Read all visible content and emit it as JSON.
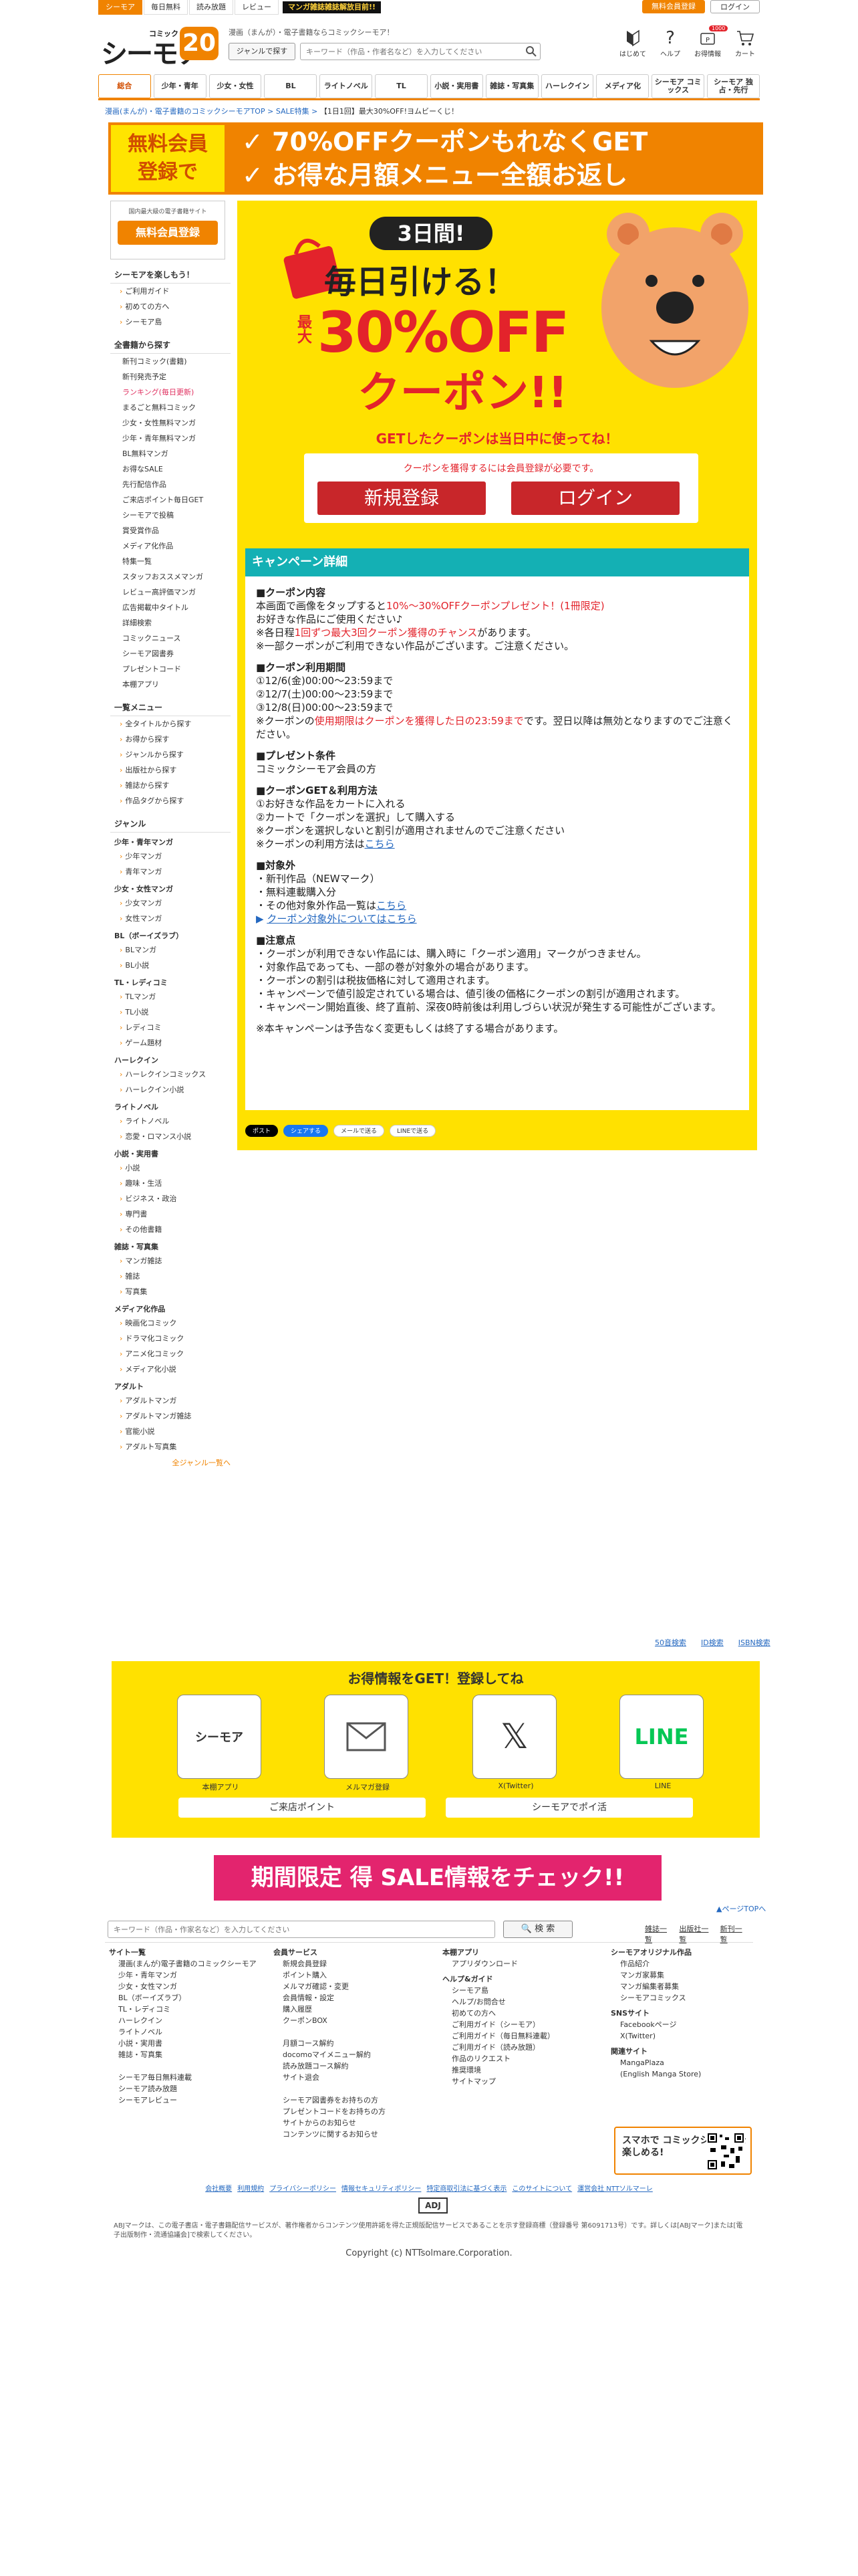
{
  "top_tabs": [
    "シーモア",
    "毎日無料",
    "読み放題",
    "レビュー"
  ],
  "top_banner": "マンガ雑誌雑誌解放目前!!",
  "top_right": {
    "register": "無料会員登録",
    "login": "ログイン"
  },
  "logo": {
    "comic": "コミック",
    "main": "シーモア",
    "anniv": "20"
  },
  "tagline": "漫画（まんが）・電子書籍ならコミックシーモア！",
  "genre_button": "ジャンルで探す",
  "search_placeholder": "キーワード（作品・作者名など）を入力してください",
  "header_icons": [
    "はじめて",
    "ヘルプ",
    "お得情報",
    "カート"
  ],
  "header_badge": "1000",
  "nav": [
    "総合",
    "少年・青年",
    "少女・女性",
    "BL",
    "ライトノベル",
    "TL",
    "小説・実用書",
    "雑誌・写真集",
    "ハーレクイン",
    "メディア化",
    "シーモア コミックス",
    "シーモア 独占・先行"
  ],
  "breadcrumb": {
    "home": "漫画(まんが)・電子書籍のコミックシーモアTOP",
    "sep": " > ",
    "sale": "SALE特集",
    "current": "【1日1回】最大30%OFF!ヨムビーくじ！"
  },
  "promo": {
    "left": [
      "無料会員",
      "登録で"
    ],
    "line1": "✓ 70%OFFクーポンもれなくGET",
    "line2": "✓ お得な月額メニュー全額お返し"
  },
  "sidebar": {
    "member_caption": "国内最大級の電子書籍サイト",
    "member_button": "無料会員登録",
    "enjoy_title": "シーモアを楽しもう！",
    "enjoy": [
      "ご利用ガイド",
      "初めての方へ",
      "シーモア島"
    ],
    "search_title": "全書籍から探す",
    "search_items": [
      "新刊コミック(書籍)",
      "新刊発売予定",
      "ランキング(毎日更新)",
      "まるごと無料コミック",
      "少女・女性無料マンガ",
      "少年・青年無料マンガ",
      "BL無料マンガ",
      "お得なSALE",
      "先行配信作品",
      "ご来店ポイント毎日GET",
      "シーモアで投稿",
      "賞受賞作品",
      "メディア化作品",
      "特集一覧",
      "スタッフおススメマンガ",
      "レビュー高評価マンガ",
      "広告掲載中タイトル",
      "詳細検索",
      "コミックニュース",
      "シーモア図書券",
      "プレゼントコード",
      "本棚アプリ"
    ],
    "list_title": "一覧メニュー",
    "list_items": [
      "全タイトルから探す",
      "お得から探す",
      "ジャンルから探す",
      "出版社から探す",
      "雑誌から探す",
      "作品タグから探す"
    ],
    "genre_title": "ジャンル",
    "genres": [
      {
        "name": "少年・青年マンガ",
        "items": [
          "少年マンガ",
          "青年マンガ"
        ]
      },
      {
        "name": "少女・女性マンガ",
        "items": [
          "少女マンガ",
          "女性マンガ"
        ]
      },
      {
        "name": "BL（ボーイズラブ）",
        "items": [
          "BLマンガ",
          "BL小説"
        ]
      },
      {
        "name": "TL・レディコミ",
        "items": [
          "TLマンガ",
          "TL小説",
          "レディコミ",
          "ゲーム題材"
        ]
      },
      {
        "name": "ハーレクイン",
        "items": [
          "ハーレクインコミックス",
          "ハーレクイン小説"
        ]
      },
      {
        "name": "ライトノベル",
        "items": [
          "ライトノベル",
          "恋愛・ロマンス小説"
        ]
      },
      {
        "name": "小説・実用書",
        "items": [
          "小説",
          "趣味・生活",
          "ビジネス・政治",
          "専門書",
          "その他書籍"
        ]
      },
      {
        "name": "雑誌・写真集",
        "items": [
          "マンガ雑誌",
          "雑誌",
          "写真集"
        ]
      },
      {
        "name": "メディア化作品",
        "items": [
          "映画化コミック",
          "ドラマ化コミック",
          "アニメ化コミック",
          "メディア化小説"
        ]
      },
      {
        "name": "アダルト",
        "items": [
          "アダルトマンガ",
          "アダルトマンガ雑誌",
          "官能小説",
          "アダルト写真集"
        ]
      }
    ],
    "all_genres": "全ジャンル一覧へ"
  },
  "hero": {
    "three_days": "3日間!",
    "daily": "毎日引ける！",
    "max": "最大",
    "percent": "30%OFF",
    "coupon": "クーポン!!"
  },
  "hero_note": "GETしたクーポンは当日中に使ってね！",
  "login_box": {
    "message": "クーポンを獲得するには会員登録が必要です。",
    "register": "新規登録",
    "login": "ログイン"
  },
  "details": {
    "title": "キャンペーン詳細",
    "coupon_title": "■クーポン内容",
    "coupon_line1a": "本画面で画像をタップすると",
    "coupon_line1b": "10%〜30%OFFクーポンプレゼント！(1冊限定)",
    "coupon_line2": "お好きな作品にご使用ください♪",
    "coupon_line3a": "※各日程",
    "coupon_line3b": "1回ずつ最大3回クーポン獲得のチャンス",
    "coupon_line3c": "があります。",
    "coupon_line4": "※一部クーポンがご利用できない作品がございます。ご注意ください。",
    "period_title": "■クーポン利用期間",
    "period": [
      "①12/6(金)00:00〜23:59まで",
      "②12/7(土)00:00〜23:59まで",
      "③12/8(日)00:00〜23:59まで"
    ],
    "period_note_a": "※クーポンの",
    "period_note_b": "使用期限はクーポンを獲得した日の23:59まで",
    "period_note_c": "です。翌日以降は無効となりますのでご注意ください。",
    "present_title": "■プレゼント条件",
    "present": "コミックシーモア会員の方",
    "get_title": "■クーポンGET＆利用方法",
    "get_steps": [
      "①お好きな作品をカートに入れる",
      "②カートで「クーポンを選択」して購入する",
      "※クーポンを選択しないと割引が適用されませんのでご注意ください"
    ],
    "get_howto": "※クーポンの利用方法は",
    "get_howto_link": "こちら",
    "target_title": "■対象外",
    "target": [
      "・新刊作品（NEWマーク）",
      "・無料連載購入分"
    ],
    "target_other": "・その他対象外作品一覧は",
    "target_other_link": "こちら",
    "target_about": "クーポン対象外についてはこちら",
    "notice_title": "■注意点",
    "notice": [
      "・クーポンが利用できない作品には、購入時に「クーポン適用」マークがつきません。",
      "・対象作品であっても、一部の巻が対象外の場合があります。",
      "・クーポンの割引は税抜価格に対して適用されます。",
      "・キャンペーンで値引設定されている場合は、値引後の価格にクーポンの割引が適用されます。",
      "・キャンペーン開始直後、終了直前、深夜0時前後は利用しづらい状況が発生する可能性がございます。"
    ],
    "notice_end": "※本キャンペーンは予告なく変更もしくは終了する場合があります。"
  },
  "share": [
    "ポスト",
    "シェアする",
    "メールで送る",
    "LINEで送る"
  ],
  "isbn_links": [
    "50音検索",
    "ID検索",
    "ISBN検索"
  ],
  "info": {
    "title": "お得情報をGET！登録してね",
    "cards": [
      "本棚アプリ",
      "メルマガ登録",
      "X(Twitter)",
      "LINE"
    ],
    "btn_point": "ご来店ポイント",
    "btn_post": "シーモアでポイ活"
  },
  "sale_banner": "期間限定 得 SALE情報をチェック!!",
  "pagetop": "▲ページTOPへ",
  "footer_search": {
    "placeholder": "キーワード（作品・作家名など）を入力してください",
    "button": "検 索",
    "links": [
      "雑誌一覧",
      "出版社一覧",
      "新刊一覧"
    ]
  },
  "footer": {
    "col1_title": "サイト一覧",
    "col1": [
      "漫画(まんが)電子書籍のコミックシーモア",
      "少年・青年マンガ",
      "少女・女性マンガ",
      "BL（ボーイズラブ）",
      "TL・レディコミ",
      "ハーレクイン",
      "ライトノベル",
      "小説・実用書",
      "雑誌・写真集",
      "",
      "シーモア毎日無料連載",
      "シーモア読み放題",
      "シーモアレビュー"
    ],
    "col2_title": "会員サービス",
    "col2": [
      "新規会員登録",
      "ポイント購入",
      "メルマガ確認・変更",
      "会員情報・設定",
      "購入履歴",
      "クーポンBOX",
      "",
      "月額コース解約",
      "docomoマイメニュー解約",
      "読み放題コース解約",
      "サイト退会",
      "",
      "シーモア図書券をお持ちの方",
      "プレゼントコードをお持ちの方",
      "サイトからのお知らせ",
      "コンテンツに関するお知らせ"
    ],
    "col3_title": "本棚アプリ",
    "col3_app": [
      "アプリダウンロード"
    ],
    "col3_help_title": "ヘルプ&ガイド",
    "col3_help": [
      "シーモア島",
      "ヘルプ/お問合せ",
      "初めての方へ",
      "ご利用ガイド（シーモア）",
      "ご利用ガイド（毎日無料連載）",
      "ご利用ガイド（読み放題）",
      "作品のリクエスト",
      "推奨環境",
      "サイトマップ"
    ],
    "col4_title": "シーモアオリジナル作品",
    "col4": [
      "作品紹介",
      "マンガ家募集",
      "マンガ編集者募集",
      "シーモアコミックス"
    ],
    "sns_title": "SNSサイト",
    "sns": [
      "Facebookページ",
      "X(Twitter)"
    ],
    "related_title": "関連サイト",
    "related": [
      "MangaPlaza",
      "(English Manga Store)"
    ],
    "qr_text": "スマホで コミックシーモアを 楽しめる!"
  },
  "legal_links": [
    "会社概要",
    "利用規約",
    "プライバシーポリシー",
    "情報セキュリティポリシー",
    "特定商取引法に基づく表示",
    "このサイトについて",
    "運営会社 NTTソルマーレ"
  ],
  "adj": "ADJ",
  "abj_text": "ABJマークは、この電子書店・電子書籍配信サービスが、著作権者からコンテンツ使用許諾を得た正規版配信サービスであることを示す登録商標（登録番号 第6091713号）です。詳しくは[ABJマーク]または[電子出版制作・流通協議会]で検索してください。",
  "copyright": "Copyright (c) NTTsolmare.Corporation."
}
